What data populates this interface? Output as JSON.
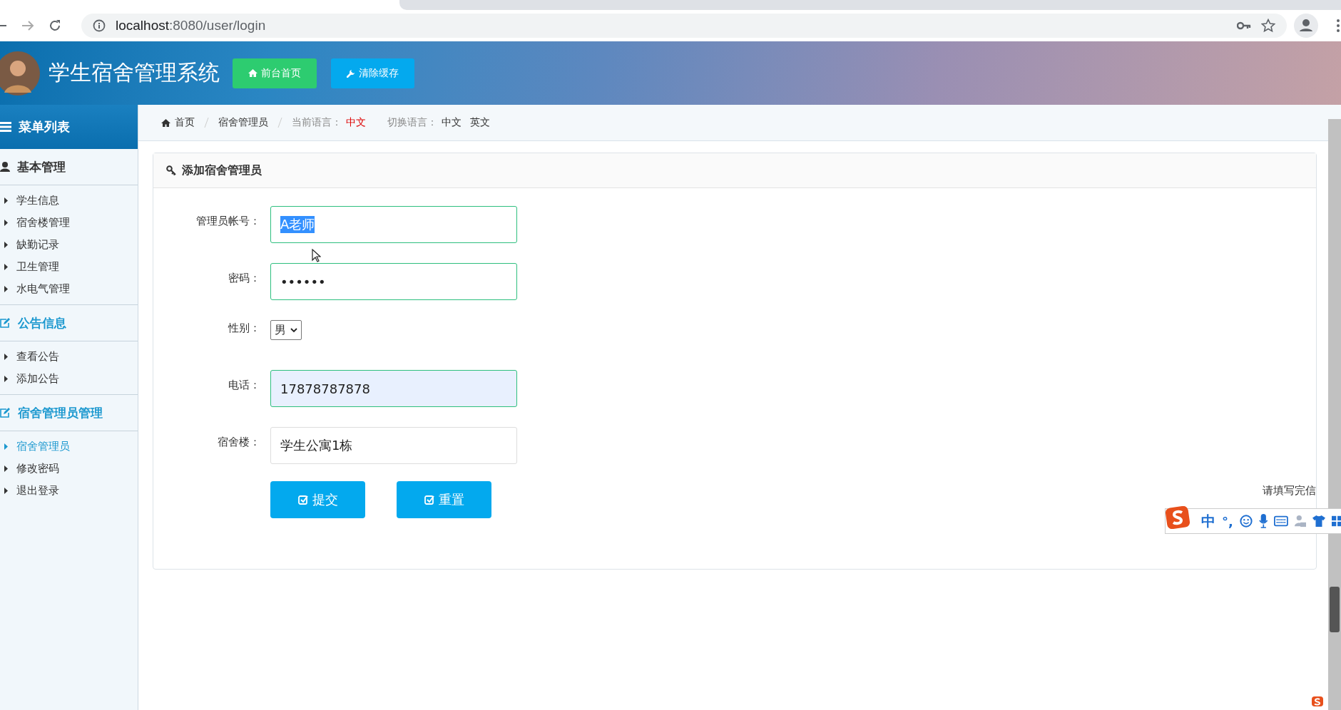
{
  "browser": {
    "host": "localhost",
    "path": ":8080/user/login"
  },
  "header": {
    "title": "学生宿舍管理系统",
    "buttons": [
      {
        "label": "前台首页",
        "kind": "home"
      },
      {
        "label": "清除缓存",
        "kind": "clear"
      }
    ]
  },
  "sidebar": {
    "title": "菜单列表",
    "groups": [
      {
        "title": "基本管理",
        "highlighted": false,
        "items": [
          {
            "label": "学生信息",
            "selected": false
          },
          {
            "label": "宿舍楼管理",
            "selected": false
          },
          {
            "label": "缺勤记录",
            "selected": false
          },
          {
            "label": "卫生管理",
            "selected": false
          },
          {
            "label": "水电气管理",
            "selected": false
          }
        ]
      },
      {
        "title": "公告信息",
        "highlighted": true,
        "items": [
          {
            "label": "查看公告",
            "selected": false
          },
          {
            "label": "添加公告",
            "selected": false
          }
        ]
      },
      {
        "title": "宿舍管理员管理",
        "highlighted": true,
        "items": [
          {
            "label": "宿舍管理员",
            "selected": true
          },
          {
            "label": "修改密码",
            "selected": false
          },
          {
            "label": "退出登录",
            "selected": false
          }
        ]
      }
    ]
  },
  "breadcrumb": {
    "items": [
      "首页",
      "宿舍管理员"
    ],
    "current_language_label": "当前语言：",
    "current_language": "中文",
    "switch_label": "切换语言：",
    "languages": [
      "中文",
      "英文"
    ]
  },
  "panel": {
    "title": "添加宿舍管理员",
    "fields": [
      {
        "label": "管理员帐号：",
        "kind": "text",
        "value": "A老师",
        "valid": true,
        "text_selected": true,
        "autofilled": false
      },
      {
        "label": "密码：",
        "kind": "text",
        "value": "••••••",
        "valid": true,
        "text_selected": false,
        "autofilled": false
      },
      {
        "label": "性别：",
        "kind": "select",
        "value": "男"
      },
      {
        "label": "电话：",
        "kind": "text",
        "value": "17878787878",
        "valid": true,
        "text_selected": false,
        "autofilled": true
      },
      {
        "label": "宿舍楼：",
        "kind": "text",
        "value": "学生公寓1栋",
        "valid": false,
        "text_selected": false,
        "autofilled": false
      }
    ],
    "buttons": [
      "提交",
      "重置"
    ],
    "hint": "请填写完信"
  },
  "ime": {
    "mode": "中",
    "punctuation": "°,"
  }
}
